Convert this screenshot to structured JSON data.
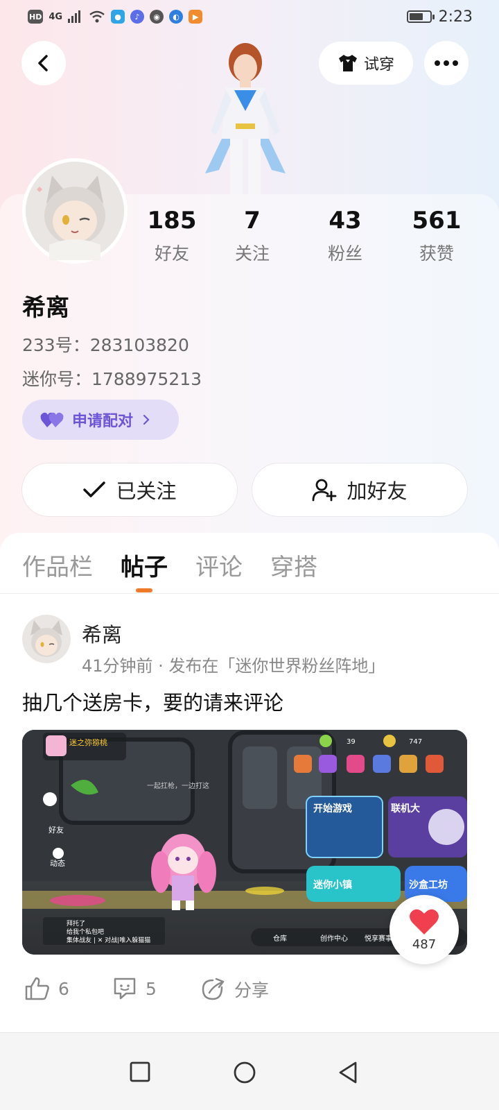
{
  "status_bar": {
    "network": "HD",
    "signal": "4G",
    "time": "2:23"
  },
  "header": {
    "back_icon": "chevron-left-icon",
    "try_on_label": "试穿",
    "more_icon": "more-dots-icon"
  },
  "profile": {
    "name": "希离",
    "id_233": "233号：283103820",
    "mini_id": "迷你号：1788975213",
    "pair_label": "申请配对",
    "stats": [
      {
        "value": "185",
        "label": "好友"
      },
      {
        "value": "7",
        "label": "关注"
      },
      {
        "value": "43",
        "label": "粉丝"
      },
      {
        "value": "561",
        "label": "获赞"
      }
    ],
    "followed_label": "已关注",
    "add_friend_label": "加好友"
  },
  "tabs": [
    "作品栏",
    "帖子",
    "评论",
    "穿搭"
  ],
  "active_tab": "帖子",
  "post": {
    "author": "希离",
    "meta": "41分钟前 · 发布在「迷你世界粉丝阵地」",
    "text": "抽几个送房卡，要的请来评论",
    "image_texts": {
      "start_game": "开始游戏",
      "online": "联机大",
      "mini_town": "迷你小镇",
      "sandbox": "沙盒工坊",
      "player_name": "迷之弥猕桃",
      "friends": "好友",
      "dynamic": "动态",
      "play_together": "一起扛枪，一边打这",
      "coins1": "39",
      "coins2": "747",
      "warehouse": "仓库",
      "creation": "创作中心",
      "events": "悦享赛事",
      "chat1": "拜托了",
      "chat2": "给我个私包吧",
      "chat3": "集体战友 | ✕ 对战|唯入躲猫猫"
    },
    "like_float_count": "487",
    "likes": "6",
    "comments": "5",
    "share_label": "分享"
  },
  "colors": {
    "accent": "#f07a2c",
    "pair_purple": "#6c55d6",
    "heart_red": "#f0404f"
  }
}
